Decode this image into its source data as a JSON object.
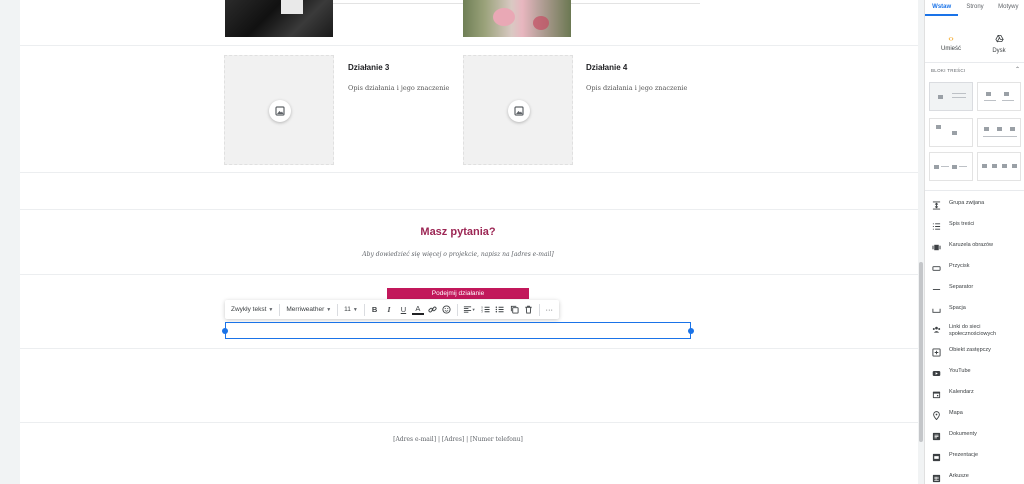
{
  "page": {
    "activities": [
      {
        "title": "Działanie 3",
        "desc": "Opis działania i jego znaczenie"
      },
      {
        "title": "Działanie 4",
        "desc": "Opis działania i jego znaczenie"
      }
    ],
    "questions_title": "Masz pytania?",
    "questions_sub": "Aby dowiedzieć się więcej o projekcie, napisz na [adres e-mail]",
    "cta_button": "Podejmij działanie",
    "footer": "[Adres e-mail]   |   [Adres]   |   [Numer telefonu]"
  },
  "toolbar": {
    "style": "Zwykły tekst",
    "font": "Merriweather",
    "size": "11",
    "icons": [
      "bold-icon",
      "italic-icon",
      "underline-icon",
      "text-color-icon",
      "link-icon",
      "emoji-icon",
      "align-icon",
      "numbered-list-icon",
      "bulleted-list-icon",
      "copy-icon",
      "delete-icon",
      "more-icon"
    ]
  },
  "side_panel": {
    "tabs": [
      "Wstaw",
      "Strony",
      "Motywy"
    ],
    "active_tab": "Wstaw",
    "quick": [
      {
        "label": "Umieść",
        "icon": "embed-icon"
      },
      {
        "label": "Dysk",
        "icon": "drive-icon"
      }
    ],
    "section_label": "BLOKI TREŚCI",
    "items": [
      {
        "label": "Grupa zwijana",
        "icon": "collapsible-icon"
      },
      {
        "label": "Spis treści",
        "icon": "toc-icon"
      },
      {
        "label": "Karuzela obrazów",
        "icon": "carousel-icon"
      },
      {
        "label": "Przycisk",
        "icon": "button-icon"
      },
      {
        "label": "Separator",
        "icon": "divider-icon"
      },
      {
        "label": "Spacja",
        "icon": "spacer-icon"
      },
      {
        "label": "Linki do sieci społecznościowych",
        "icon": "social-links-icon"
      },
      {
        "label": "Obiekt zastępczy",
        "icon": "placeholder-icon"
      },
      {
        "label": "YouTube",
        "icon": "youtube-icon"
      },
      {
        "label": "Kalendarz",
        "icon": "calendar-icon"
      },
      {
        "label": "Mapa",
        "icon": "map-pin-icon"
      },
      {
        "label": "Dokumenty",
        "icon": "docs-icon"
      },
      {
        "label": "Prezentacje",
        "icon": "slides-icon"
      },
      {
        "label": "Arkusze",
        "icon": "sheets-icon"
      }
    ]
  },
  "colors": {
    "accent": "#1a73e8",
    "heading": "#9c2654",
    "cta": "#c2185b"
  }
}
